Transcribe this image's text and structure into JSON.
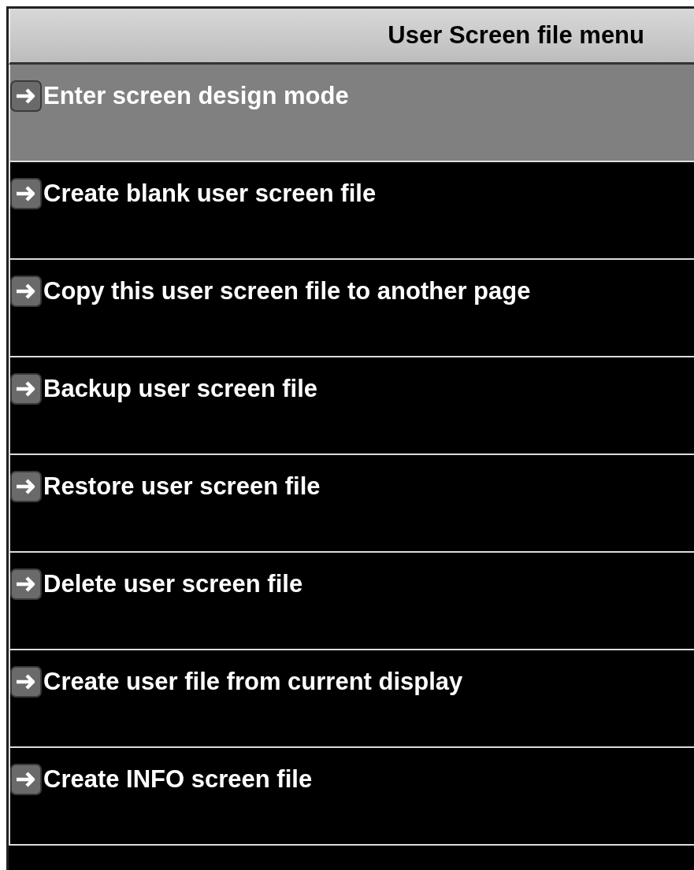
{
  "header": {
    "title": "User Screen file menu"
  },
  "items": [
    {
      "label": "Enter screen design mode",
      "selected": true
    },
    {
      "label": "Create blank user screen file",
      "selected": false
    },
    {
      "label": "Copy this user screen file to another page",
      "selected": false
    },
    {
      "label": "Backup user screen file",
      "selected": false
    },
    {
      "label": "Restore user screen file",
      "selected": false
    },
    {
      "label": "Delete user screen file",
      "selected": false
    },
    {
      "label": "Create user file from current display",
      "selected": false
    },
    {
      "label": "Create INFO screen file",
      "selected": false
    }
  ]
}
